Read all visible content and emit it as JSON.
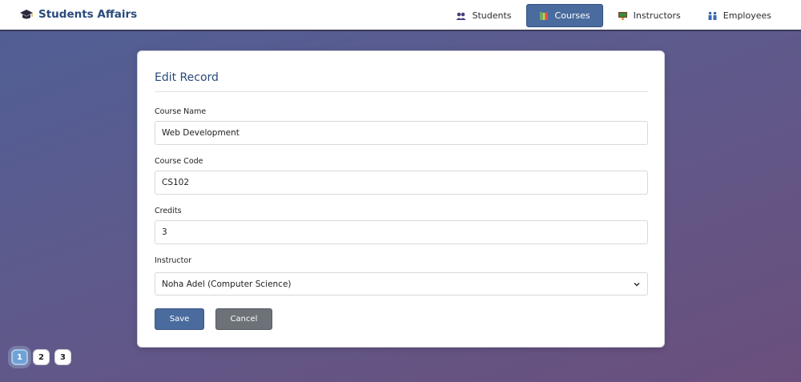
{
  "brand": {
    "title": "Students Affairs",
    "icon": "graduation-cap-icon"
  },
  "nav": {
    "items": [
      {
        "label": "Students",
        "icon": "users-icon",
        "active": false
      },
      {
        "label": "Courses",
        "icon": "books-icon",
        "active": true
      },
      {
        "label": "Instructors",
        "icon": "instructor-board-icon",
        "active": false
      },
      {
        "label": "Employees",
        "icon": "employees-icon",
        "active": false
      }
    ]
  },
  "form": {
    "title": "Edit Record",
    "course_name": {
      "label": "Course Name",
      "value": "Web Development"
    },
    "course_code": {
      "label": "Course Code",
      "value": "CS102"
    },
    "credits": {
      "label": "Credits",
      "value": "3"
    },
    "instructor": {
      "label": "Instructor",
      "selected": "Noha Adel (Computer Science)"
    },
    "save_label": "Save",
    "cancel_label": "Cancel"
  },
  "pagination": {
    "pages": [
      "1",
      "2",
      "3"
    ],
    "current": "1"
  },
  "colors": {
    "accent": "#4a6b9e",
    "brand_text": "#2a4a7a",
    "cancel": "#6c7278"
  }
}
